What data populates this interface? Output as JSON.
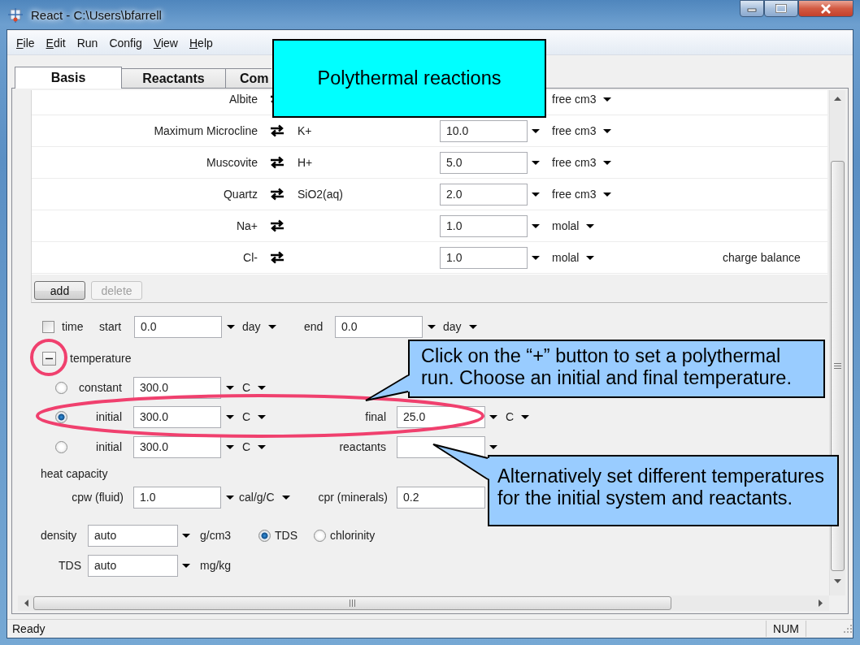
{
  "window": {
    "title": "React - C:\\Users\\bfarrell"
  },
  "menu": [
    {
      "label": "File",
      "access_key": true
    },
    {
      "label": "Edit",
      "access_key": true
    },
    {
      "label": "Run",
      "access_key": false
    },
    {
      "label": "Config",
      "access_key": false
    },
    {
      "label": "View",
      "access_key": true
    },
    {
      "label": "Help",
      "access_key": true
    }
  ],
  "tabs": [
    {
      "label": "Basis",
      "selected": true
    },
    {
      "label": "Reactants",
      "selected": false
    },
    {
      "label": "Com",
      "selected": false
    }
  ],
  "basis_rows": [
    {
      "name": "Albite",
      "unit": "free cm3"
    },
    {
      "name": "Maximum Microcline",
      "species": "K+",
      "value": "10.0",
      "unit": "free cm3"
    },
    {
      "name": "Muscovite",
      "species": "H+",
      "value": "5.0",
      "unit": "free cm3"
    },
    {
      "name": "Quartz",
      "species": "SiO2(aq)",
      "value": "2.0",
      "unit": "free cm3"
    },
    {
      "name": "Na+",
      "value": "1.0",
      "unit": "molal"
    },
    {
      "name": "Cl-",
      "value": "1.0",
      "unit": "molal",
      "constraint": "charge balance"
    }
  ],
  "basis_buttons": [
    {
      "label": "add",
      "disabled": false
    },
    {
      "label": "delete",
      "disabled": true
    }
  ],
  "time": {
    "label": "time",
    "checked": false,
    "start_label": "start",
    "start": "0.0",
    "start_unit": "day",
    "end_label": "end",
    "end": "0.0",
    "end_unit": "day"
  },
  "temperature": {
    "label": "temperature",
    "expanded": true,
    "options": [
      {
        "label": "constant",
        "selected": false,
        "value": "300.0",
        "unit": "C"
      },
      {
        "label": "initial",
        "selected": true,
        "value": "300.0",
        "unit": "C",
        "second_label": "final",
        "second_value": "25.0",
        "second_unit": "C"
      },
      {
        "label": "initial",
        "selected": false,
        "value": "300.0",
        "unit": "C",
        "second_label": "reactants"
      }
    ]
  },
  "heat_capacity": {
    "label": "heat capacity",
    "cpw_label": "cpw (fluid)",
    "cpw": "1.0",
    "cpw_unit": "cal/g/C",
    "cpr_label": "cpr (minerals)",
    "cpr": "0.2"
  },
  "density": {
    "label": "density",
    "value": "auto",
    "unit": "g/cm3",
    "basis": [
      {
        "label": "TDS",
        "selected": true
      },
      {
        "label": "chlorinity",
        "selected": false
      }
    ]
  },
  "tds": {
    "label": "TDS",
    "value": "auto",
    "unit": "mg/kg"
  },
  "status_bar": {
    "message": "Ready",
    "indicator": "NUM"
  },
  "callouts": [
    {
      "kind": "title",
      "text": "Polythermal reactions"
    },
    {
      "kind": "speech",
      "text": "Click on the “+” button to set a polythermal run. Choose an initial and final temperature."
    },
    {
      "kind": "speech",
      "text": "Alternatively set different temperatures for the initial system and reactants."
    }
  ]
}
